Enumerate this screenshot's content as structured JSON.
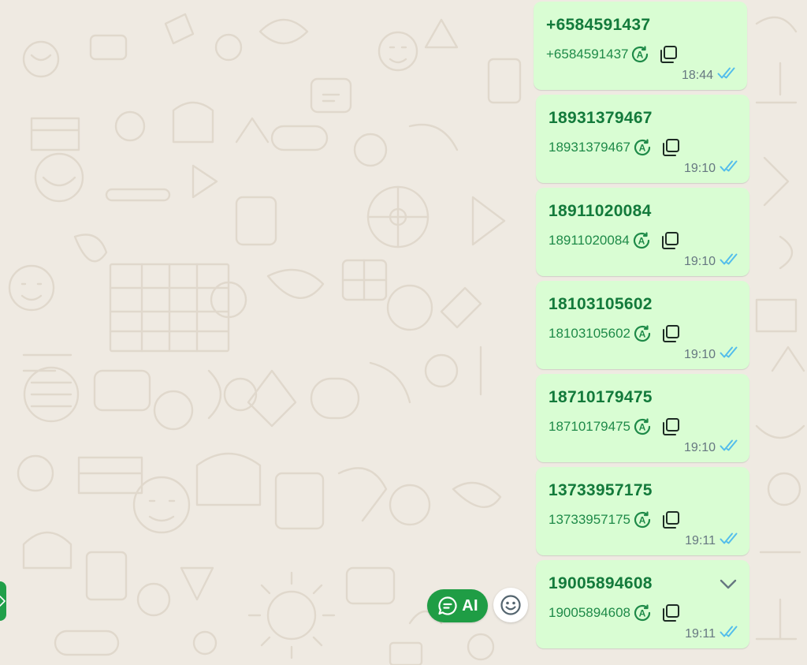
{
  "chat": {
    "messages": [
      {
        "title": "+6584591437",
        "number": "+6584591437",
        "time": "18:44",
        "status": "read"
      },
      {
        "title": "18931379467",
        "number": "18931379467",
        "time": "19:10",
        "status": "read"
      },
      {
        "title": "18911020084",
        "number": "18911020084",
        "time": "19:10",
        "status": "read"
      },
      {
        "title": "18103105602",
        "number": "18103105602",
        "time": "19:10",
        "status": "read"
      },
      {
        "title": "18710179475",
        "number": "18710179475",
        "time": "19:10",
        "status": "read"
      },
      {
        "title": "13733957175",
        "number": "13733957175",
        "time": "19:11",
        "status": "read"
      },
      {
        "title": "19005894608",
        "number": "19005894608",
        "time": "19:11",
        "status": "read"
      }
    ]
  },
  "controls": {
    "ai_label": "AI",
    "ai_icon": "chat-bubble-icon",
    "emoji_icon": "smiley-icon",
    "side_tab_icon": "chevron-right-icon",
    "message_menu_icon": "chevron-down-icon",
    "translate_icon": "auto-translate-icon",
    "copy_icon": "copy-icon",
    "read_receipt_icon": "double-check-icon"
  },
  "colors": {
    "background": "#efeae2",
    "bubble": "#d9fdd3",
    "accent_green": "#1f9d45",
    "title_text": "#137a3b",
    "read_receipt": "#53bdeb",
    "time_text": "#667781"
  }
}
